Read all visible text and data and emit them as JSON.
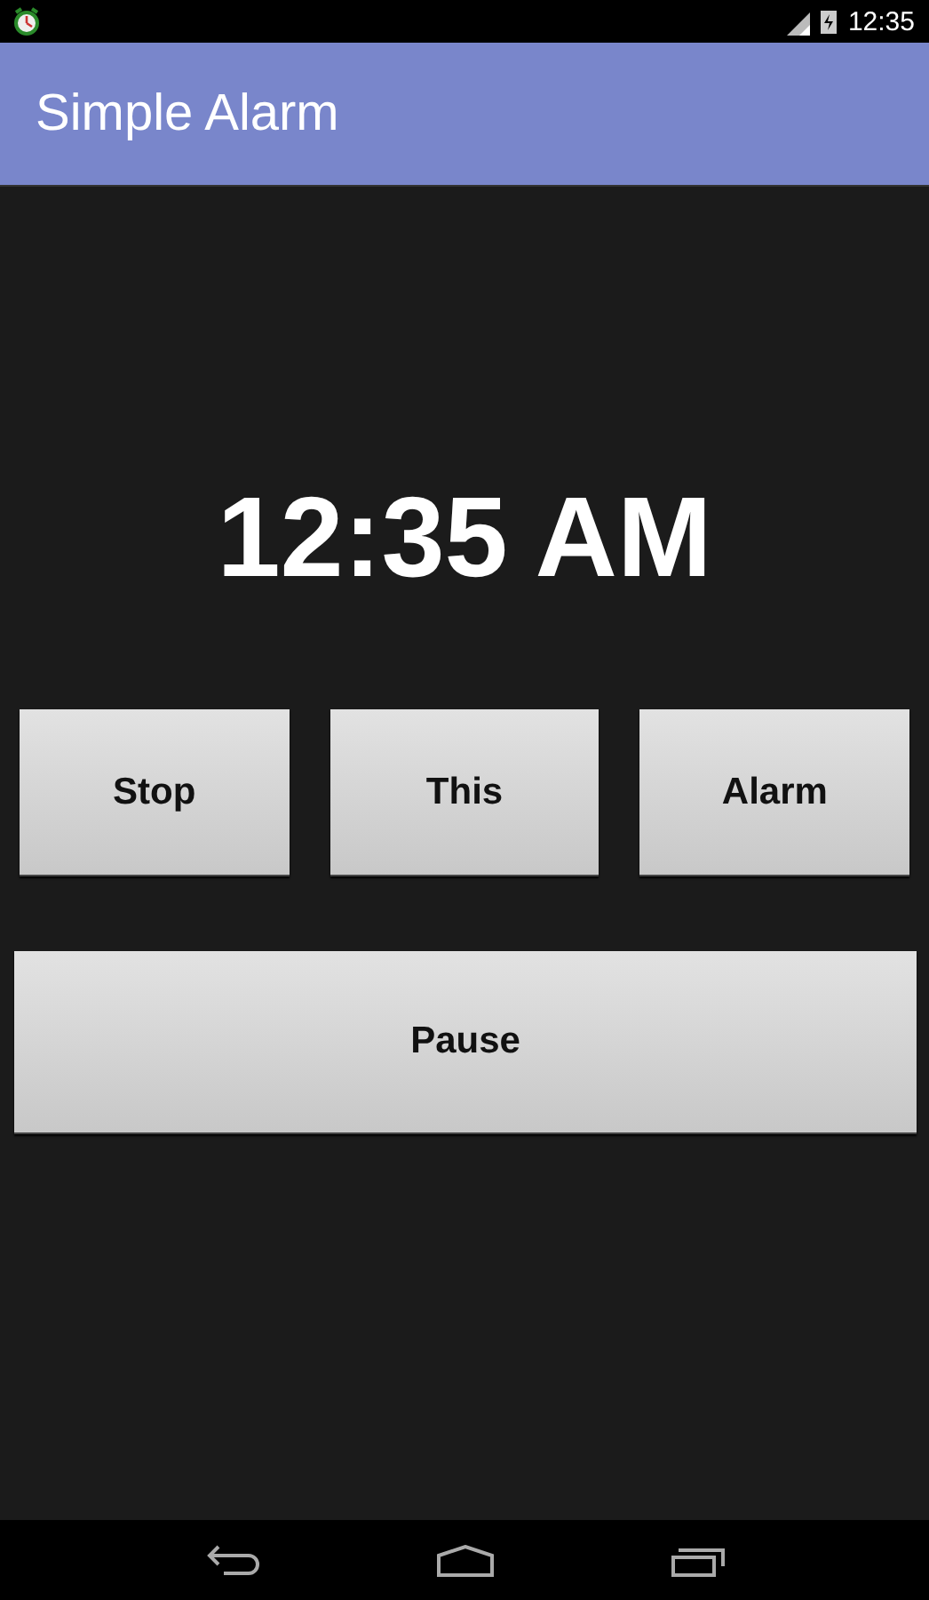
{
  "status_bar": {
    "time": "12:35"
  },
  "app_bar": {
    "title": "Simple Alarm"
  },
  "clock": "12:35 AM",
  "buttons": [
    "Stop",
    "This",
    "Alarm"
  ],
  "wide_button": "Pause"
}
